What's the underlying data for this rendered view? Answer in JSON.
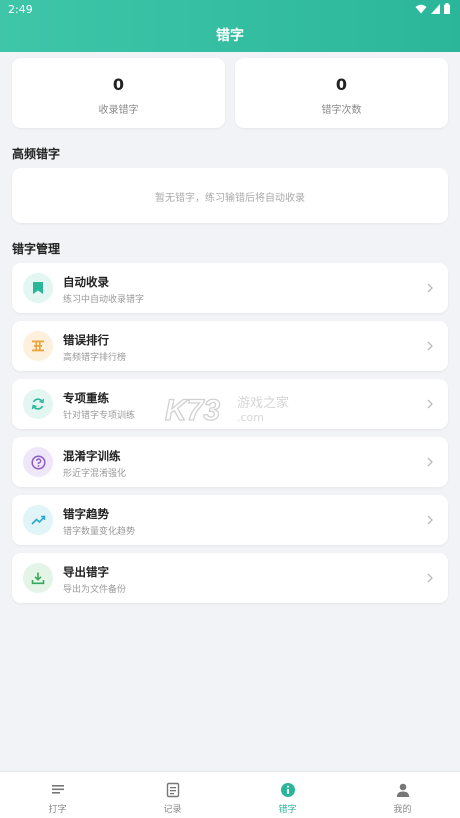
{
  "status_bar": {
    "time": "2:49"
  },
  "app_bar": {
    "title": "错字"
  },
  "stats": [
    {
      "value": "0",
      "label": "收录错字"
    },
    {
      "value": "0",
      "label": "错字次数"
    }
  ],
  "frequent": {
    "title": "高频错字",
    "empty_text": "暂无错字，练习输错后将自动收录"
  },
  "management": {
    "title": "错字管理",
    "items": [
      {
        "title": "自动收录",
        "subtitle": "练习中自动收录错字",
        "icon": "bookmark-icon",
        "color": "#2bb69a",
        "bg": "#e3f6f1"
      },
      {
        "title": "错误排行",
        "subtitle": "高频错字排行榜",
        "icon": "ranking-icon",
        "color": "#e8a33a",
        "bg": "#fdf1de"
      },
      {
        "title": "专项重练",
        "subtitle": "针对错字专项训练",
        "icon": "refresh-icon",
        "color": "#2bb69a",
        "bg": "#e3f6f1"
      },
      {
        "title": "混淆字训练",
        "subtitle": "形近字混淆强化",
        "icon": "question-icon",
        "color": "#8a5cc7",
        "bg": "#efe7f8"
      },
      {
        "title": "错字趋势",
        "subtitle": "错字数量变化趋势",
        "icon": "trend-icon",
        "color": "#2aa7c9",
        "bg": "#e1f4f8"
      },
      {
        "title": "导出错字",
        "subtitle": "导出为文件备份",
        "icon": "download-icon",
        "color": "#3aa85a",
        "bg": "#e4f5e8"
      }
    ]
  },
  "bottom_nav": [
    {
      "label": "打字",
      "icon": "text-lines-icon"
    },
    {
      "label": "记录",
      "icon": "document-icon"
    },
    {
      "label": "错字",
      "icon": "info-icon",
      "active": true
    },
    {
      "label": "我的",
      "icon": "person-icon"
    }
  ],
  "watermark": {
    "brand": "K73",
    "text": "游戏之家",
    "domain": ".com"
  },
  "colors": {
    "accent": "#2bb69a",
    "background": "#f2f3f7"
  }
}
